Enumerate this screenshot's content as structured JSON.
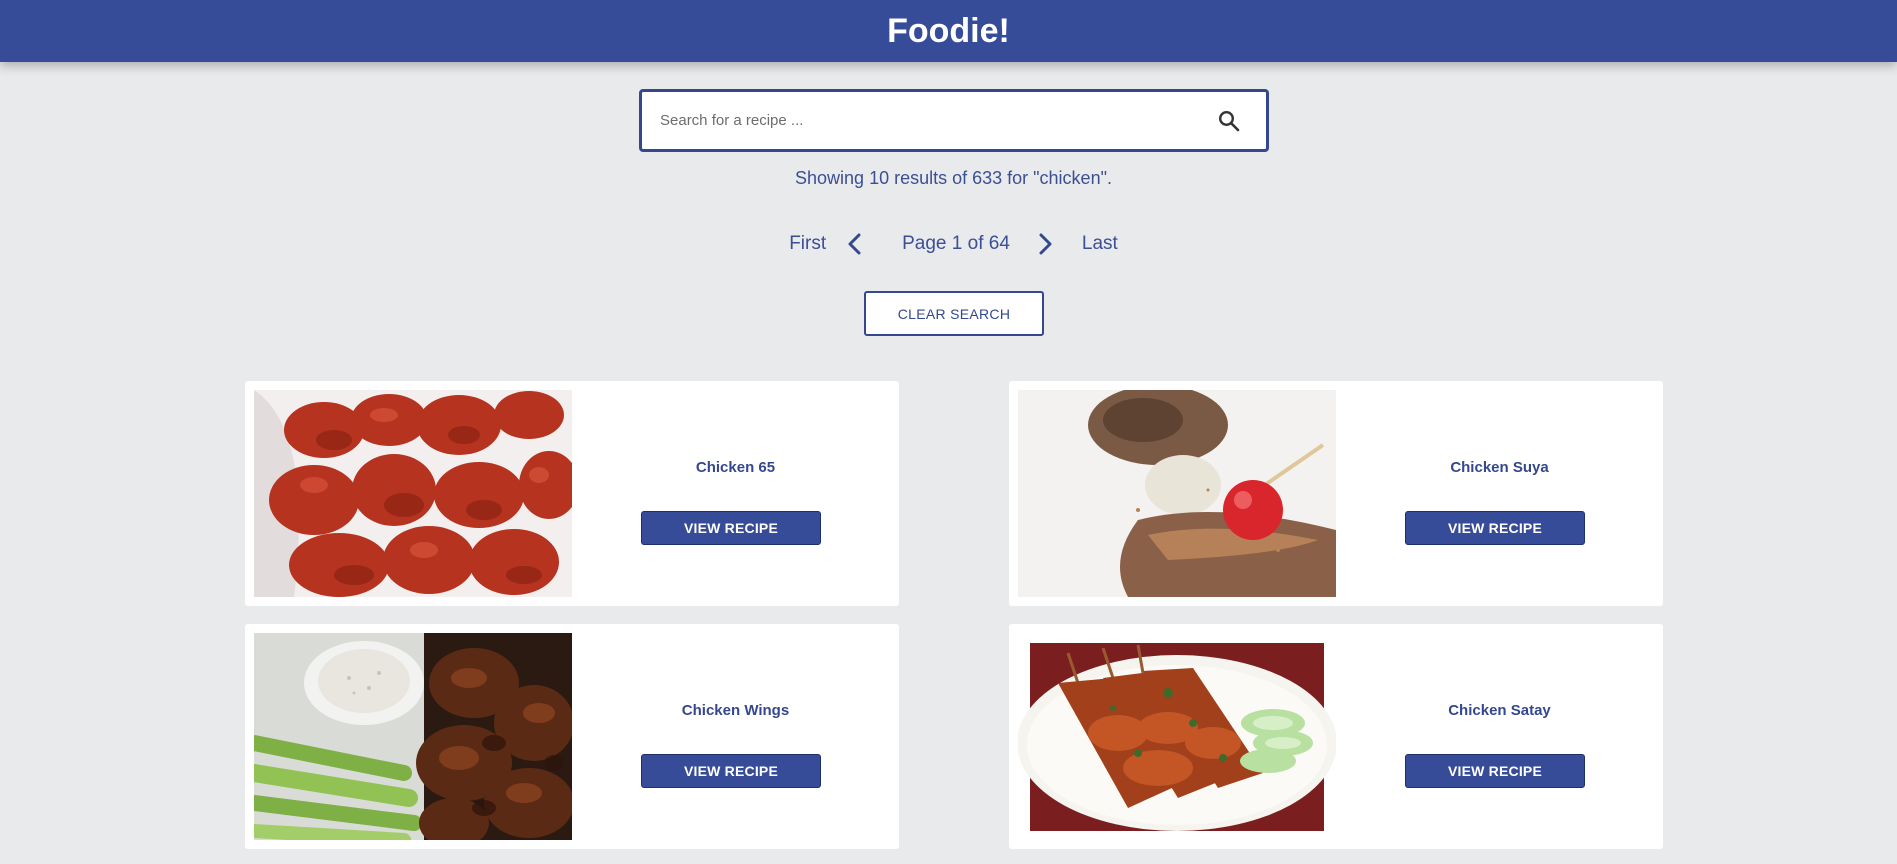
{
  "header": {
    "brand": "Foodie!"
  },
  "search": {
    "placeholder": "Search for a recipe ...",
    "value": "",
    "icon": "search-icon"
  },
  "results_text": "Showing 10 results of 633 for \"chicken\".",
  "pagination": {
    "first_label": "First",
    "page_text": "Page 1 of 64",
    "last_label": "Last",
    "current_page": 1,
    "total_pages": 64
  },
  "clear_label": "CLEAR SEARCH",
  "colors": {
    "primary": "#374c99",
    "background": "#e9eaec",
    "card": "#ffffff"
  },
  "recipes": [
    {
      "title": "Chicken 65",
      "button": "VIEW RECIPE"
    },
    {
      "title": "Chicken Suya",
      "button": "VIEW RECIPE"
    },
    {
      "title": "Chicken Wings",
      "button": "VIEW RECIPE"
    },
    {
      "title": "Chicken Satay",
      "button": "VIEW RECIPE"
    }
  ]
}
